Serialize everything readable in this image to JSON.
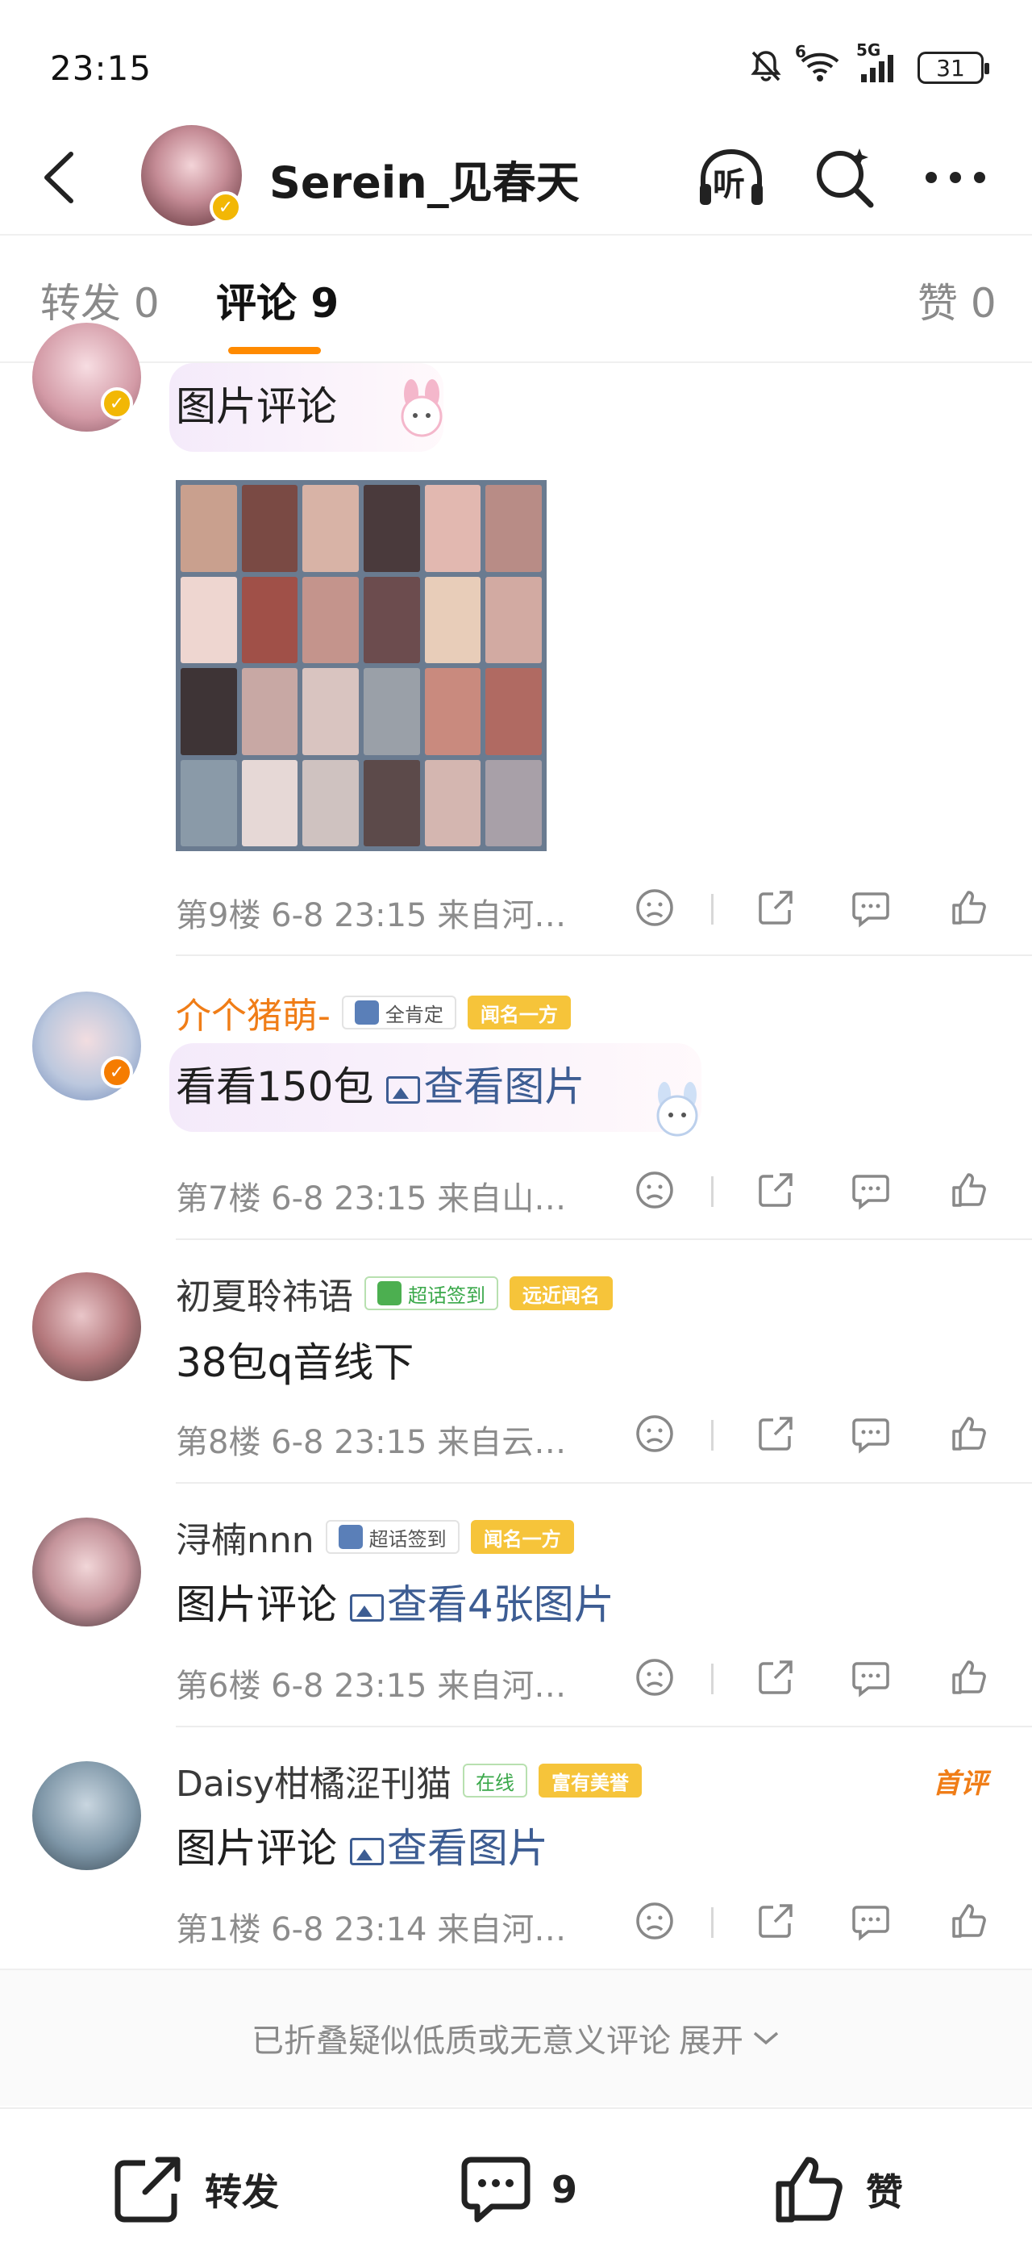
{
  "status_bar": {
    "time": "23:15",
    "battery": "31",
    "network": "5G",
    "wifi_sub": "6"
  },
  "header": {
    "title": "Serein_见春天",
    "listen_label": "听"
  },
  "tabs": [
    {
      "label": "转发 0"
    },
    {
      "label": "评论 9"
    },
    {
      "label": "赞 0"
    }
  ],
  "comments": [
    {
      "text": "图片评论",
      "meta": "第9楼 6-8 23:15 来自河…"
    },
    {
      "name": "介个猪萌-",
      "badges": [
        "全肯定",
        "闻名一方"
      ],
      "text_prefix": "看看150包",
      "link": "查看图片",
      "meta": "第7楼 6-8 23:15 来自山…"
    },
    {
      "name": "初夏聆祎语",
      "badges": [
        "超话签到",
        "远近闻名"
      ],
      "text": "38包q音线下",
      "meta": "第8楼 6-8 23:15 来自云…"
    },
    {
      "name": "浔楠nnn",
      "badges": [
        "超话签到",
        "闻名一方"
      ],
      "text_prefix": "图片评论",
      "link": "查看4张图片",
      "meta": "第6楼 6-8 23:15 来自河…"
    },
    {
      "name": "Daisy柑橘涩刊猫",
      "badges": [
        "在线",
        "富有美誉"
      ],
      "top_pick": "首评",
      "text_prefix": "图片评论",
      "link": "查看图片",
      "meta": "第1楼 6-8 23:14 来自河…"
    }
  ],
  "folded": {
    "text": "已折叠疑似低质或无意义评论",
    "expand": "展开"
  },
  "bottom_bar": {
    "repost": "转发",
    "comment_count": "9",
    "like": "赞"
  },
  "colors": {
    "accent": "#ff8a00",
    "link": "#3d5d93",
    "verified": "#f2b705"
  },
  "icons": [
    "back-arrow-icon",
    "headphones-icon",
    "search-sparkle-icon",
    "more-icon",
    "dislike-icon",
    "share-icon",
    "reply-icon",
    "like-icon"
  ]
}
